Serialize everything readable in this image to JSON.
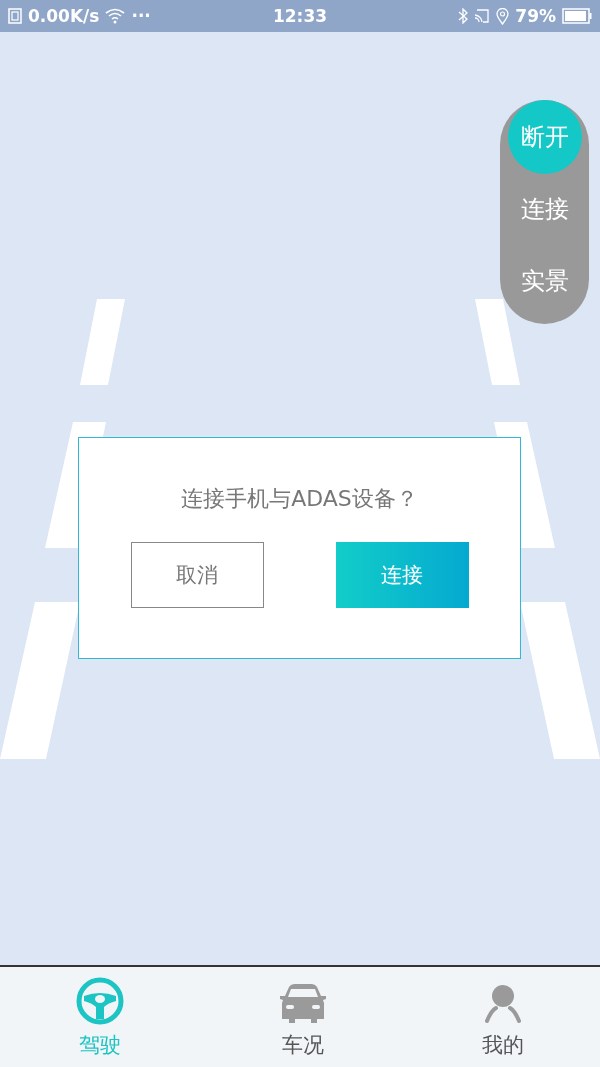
{
  "status_bar": {
    "speed": "0.00K/s",
    "more": "···",
    "time": "12:33",
    "battery": "79%"
  },
  "side_menu": [
    {
      "label": "断开",
      "selected": true
    },
    {
      "label": "连接",
      "selected": false
    },
    {
      "label": "实景",
      "selected": false
    }
  ],
  "dialog": {
    "message": "连接手机与ADAS设备？",
    "buttons": [
      {
        "label": "取消",
        "kind": "secondary"
      },
      {
        "label": "连接",
        "kind": "primary"
      }
    ]
  },
  "tabs": [
    {
      "label": "驾驶",
      "kind": "wheel",
      "selected": true
    },
    {
      "label": "车况",
      "kind": "car",
      "selected": false
    },
    {
      "label": "我的",
      "kind": "person",
      "selected": false
    }
  ]
}
